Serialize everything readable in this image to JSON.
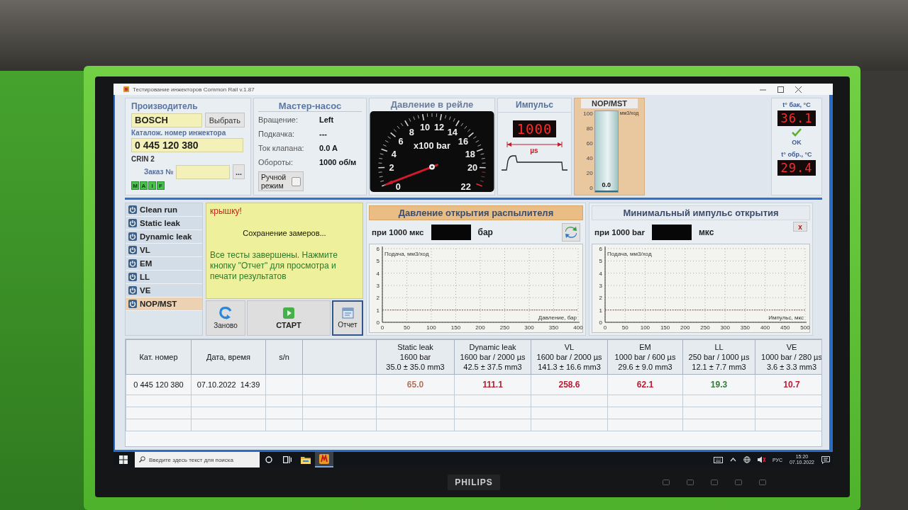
{
  "monitor": {
    "brand": "PHILIPS"
  },
  "window": {
    "title": "Тестирование инжекторов Common Rail v.1.87"
  },
  "injector": {
    "title": "Производитель",
    "manufacturer": "BOSCH",
    "choose_button": "Выбрать",
    "catalog_label": "Каталож. номер инжектора",
    "catalog_number": "0 445 120 380",
    "type": "CRIN 2",
    "order_label": "Заказ №",
    "order_button": "...",
    "indicators": [
      {
        "label": "M",
        "on": true
      },
      {
        "label": "A",
        "on": true
      },
      {
        "label": "I",
        "on": true
      },
      {
        "label": "F",
        "on": true
      }
    ]
  },
  "master_pump": {
    "title": "Мастер-насос",
    "rows": [
      {
        "label": "Вращение:",
        "value": "Left"
      },
      {
        "label": "Подкачка:",
        "value": "---"
      },
      {
        "label": "Ток клапана:",
        "value": "0.0 A"
      },
      {
        "label": "Обороты:",
        "value": "1000 об/м"
      }
    ],
    "manual_mode": {
      "label": "Ручной режим",
      "checked": false
    }
  },
  "rail_pressure": {
    "title": "Давление в рейле",
    "unit": "x100 bar",
    "scale": [
      "0",
      "2",
      "4",
      "6",
      "8",
      "10",
      "12",
      "14",
      "16",
      "18",
      "20",
      "22"
    ],
    "level": 0
  },
  "pulse": {
    "title": "Импульс",
    "reading": "1000",
    "unit": "µs"
  },
  "nop_mst": {
    "title": "NOP/MST",
    "unit": "мм3/ход",
    "scale": [
      "100",
      "80",
      "60",
      "40",
      "20",
      "0"
    ],
    "level": 0,
    "reading": "0.0"
  },
  "temperatures": {
    "tank_label": "t° бак, °C",
    "tank_reading": "36.1",
    "ok": true,
    "status_label": "OK",
    "return_label": "t° обр., °C",
    "return_reading": "29.4"
  },
  "tests": [
    {
      "label": "Clean run",
      "selected": false
    },
    {
      "label": "Static leak",
      "selected": false
    },
    {
      "label": "Dynamic leak",
      "selected": false
    },
    {
      "label": "VL",
      "selected": false
    },
    {
      "label": "EM",
      "selected": false
    },
    {
      "label": "LL",
      "selected": false
    },
    {
      "label": "VE",
      "selected": false
    },
    {
      "label": "NOP/MST",
      "selected": true
    }
  ],
  "messages": [
    {
      "kind": "warning",
      "text": "крышку!"
    },
    {
      "kind": "info",
      "text": "Сохранение замеров..."
    },
    {
      "kind": "success",
      "text": "Все тесты завершены. Нажмите кнопку \"Отчет\" для просмотра и печати результатов"
    }
  ],
  "actions": [
    {
      "kind": "restart",
      "label": "Заново",
      "focused": false
    },
    {
      "kind": "start",
      "label": "СТАРТ",
      "focused": false
    },
    {
      "kind": "report",
      "label": "Отчет",
      "focused": true
    }
  ],
  "charts": [
    {
      "title": "Давление открытия распылителя",
      "selected": true,
      "condition": "при 1000 мкс",
      "unit": "бар",
      "tool": {
        "kind": "refresh"
      },
      "chart_data": {
        "type": "line",
        "xlabel": "Давление, бар",
        "ylabel": "Подача, мм3/ход",
        "xlim": [
          0,
          400
        ],
        "ylim": [
          0,
          6
        ],
        "xticks": [
          0,
          50,
          100,
          150,
          200,
          250,
          300,
          350,
          400
        ],
        "yticks": [
          0,
          1,
          2,
          3,
          4,
          5,
          6
        ],
        "grid": true,
        "ref_lines": [
          {
            "axis": "y",
            "value": 1
          }
        ]
      }
    },
    {
      "title": "Минимальный импульс открытия",
      "selected": false,
      "condition": "при 1000 bar",
      "unit": "мкс",
      "tool": {
        "kind": "close",
        "label": "x"
      },
      "chart_data": {
        "type": "line",
        "xlabel": "Импульс, мкс",
        "ylabel": "Подача, мм3/ход",
        "xlim": [
          0,
          500
        ],
        "ylim": [
          0,
          6
        ],
        "xticks": [
          0,
          50,
          100,
          150,
          200,
          250,
          300,
          350,
          400,
          450,
          500
        ],
        "yticks": [
          0,
          1,
          2,
          3,
          4,
          5,
          6
        ],
        "grid": true,
        "ref_lines": [
          {
            "axis": "y",
            "value": 1
          }
        ]
      }
    }
  ],
  "table": {
    "columns": [
      {
        "kind": "catalog",
        "lines": [
          "Кат. номер"
        ]
      },
      {
        "kind": "datetime",
        "lines": [
          "Дата, время"
        ]
      },
      {
        "kind": "serial",
        "lines": [
          "s/n"
        ]
      },
      {
        "kind": "blank"
      },
      {
        "kind": "test",
        "lines": [
          "Static leak",
          "1600 bar",
          "35.0 ± 35.0 mm3"
        ]
      },
      {
        "kind": "test",
        "lines": [
          "Dynamic leak",
          "1600 bar / 2000 µs",
          "42.5 ± 37.5 mm3"
        ]
      },
      {
        "kind": "test",
        "lines": [
          "VL",
          "1600 bar / 2000 µs",
          "141.3 ± 16.6 mm3"
        ]
      },
      {
        "kind": "test",
        "lines": [
          "EM",
          "1000 bar / 600 µs",
          "29.6 ± 9.0 mm3"
        ]
      },
      {
        "kind": "test",
        "lines": [
          "LL",
          "250 bar / 1000 µs",
          "12.1 ± 7.7 mm3"
        ]
      },
      {
        "kind": "test",
        "lines": [
          "VE",
          "1000 bar / 280 µs",
          "3.6 ± 3.3 mm3"
        ]
      }
    ],
    "rows": [
      {
        "catalog": "0 445 120 380",
        "datetime": "07.10.2022  14:39",
        "results": [
          {
            "value": "65.0",
            "color": "#b8705a"
          },
          {
            "value": "111.1",
            "color": "#c0182f"
          },
          {
            "value": "258.6",
            "color": "#c0182f"
          },
          {
            "value": "62.1",
            "color": "#c0182f"
          },
          {
            "value": "19.3",
            "color": "#2e7d32"
          },
          {
            "value": "10.7",
            "color": "#c0182f"
          }
        ]
      }
    ]
  },
  "taskbar": {
    "search_placeholder": "Введите здесь текст для поиска",
    "buttons": [
      {
        "kind": "cortana",
        "selected": false
      },
      {
        "kind": "task-view",
        "selected": false
      },
      {
        "kind": "explorer",
        "selected": false
      },
      {
        "kind": "tester",
        "selected": true
      }
    ],
    "language": "РУС",
    "time": "15:20",
    "date": "07.10.2022"
  }
}
